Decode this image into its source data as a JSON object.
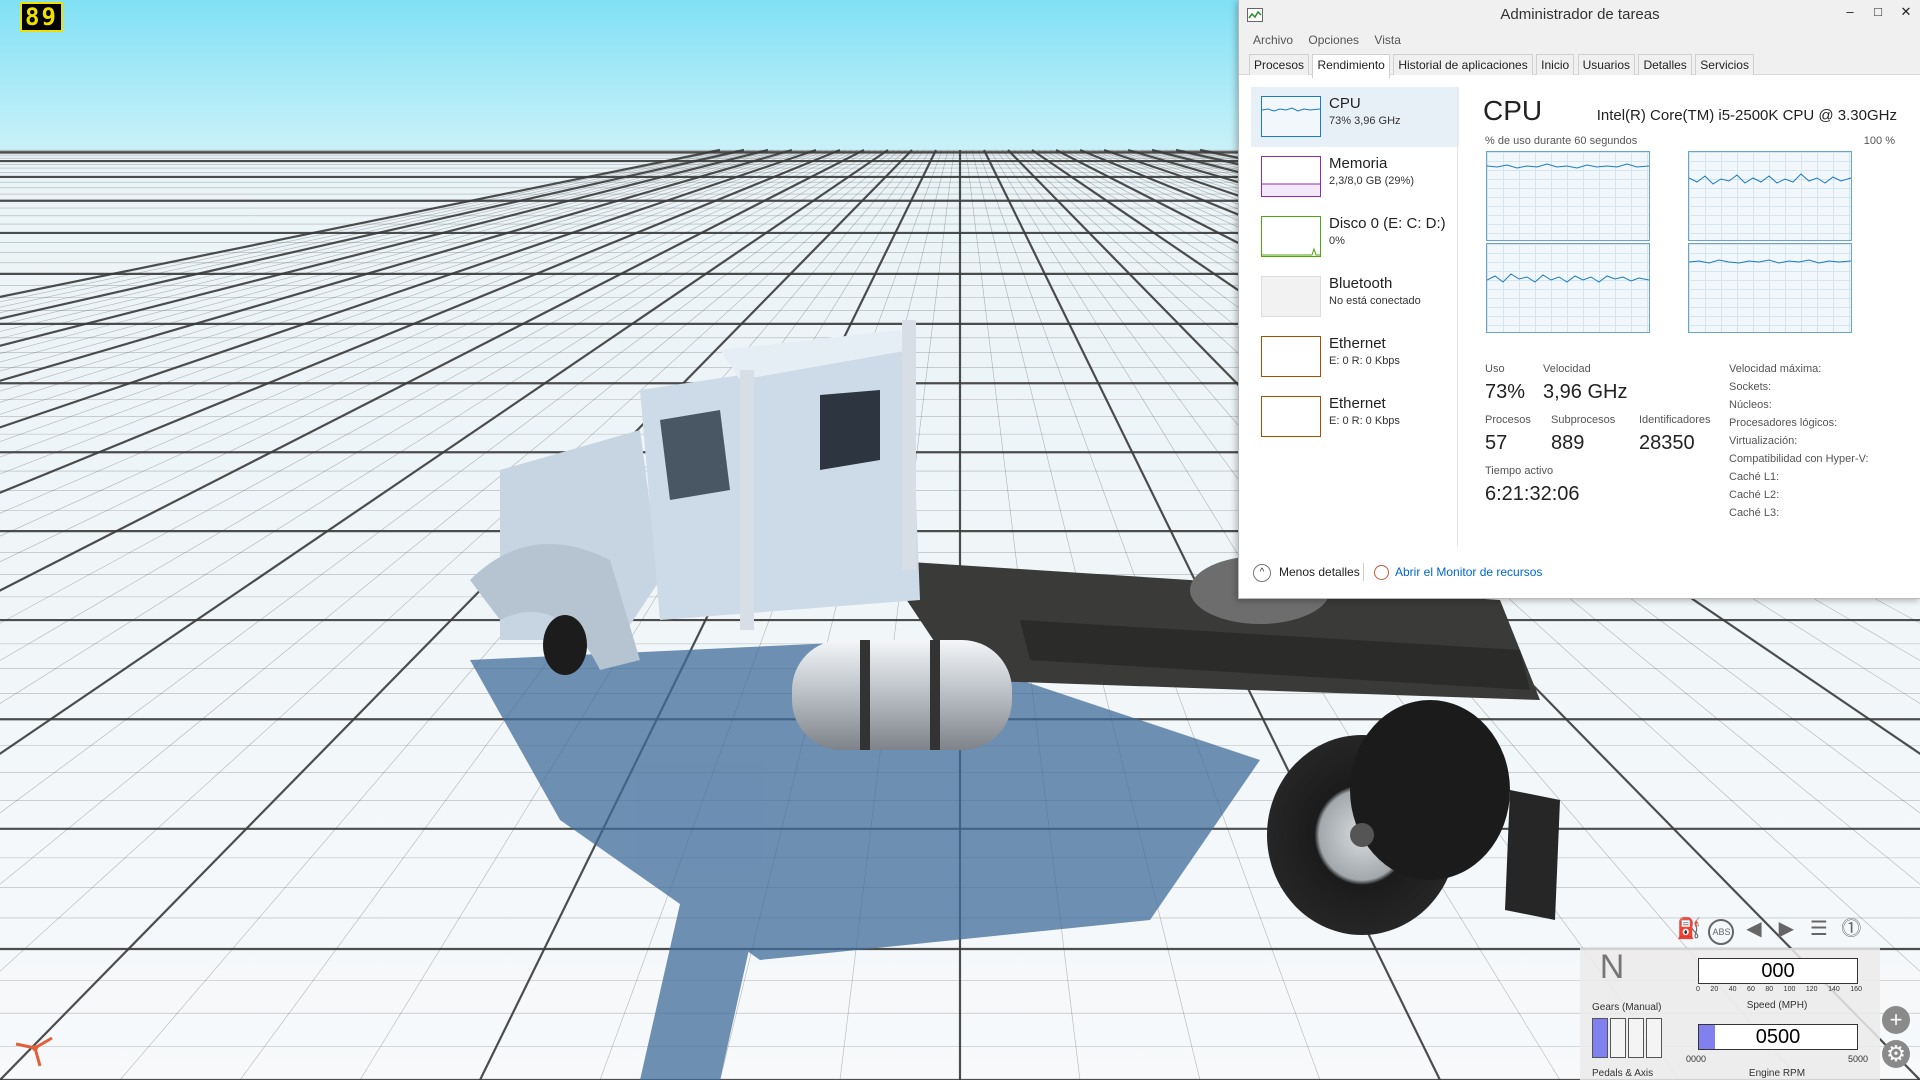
{
  "game": {
    "fps": "89",
    "colors": {
      "sky": "#a6e6f3",
      "ground": "#f2f6f8",
      "truck": "#c9d6e3"
    }
  },
  "taskmanager": {
    "title": "Administrador de tareas",
    "menu": [
      "Archivo",
      "Opciones",
      "Vista"
    ],
    "tabs": [
      "Procesos",
      "Rendimiento",
      "Historial de aplicaciones",
      "Inicio",
      "Usuarios",
      "Detalles",
      "Servicios"
    ],
    "active_tab": "Rendimiento",
    "sidebar": [
      {
        "name": "CPU",
        "sub": "73% 3,96 GHz",
        "color": "#1a7ac4"
      },
      {
        "name": "Memoria",
        "sub": "2,3/8,0 GB (29%)",
        "color": "#8b2bb9"
      },
      {
        "name": "Disco 0 (E: C: D:)",
        "sub": "0%",
        "color": "#4da60c"
      },
      {
        "name": "Bluetooth",
        "sub": "No está conectado",
        "color": "#c0c0c0"
      },
      {
        "name": "Ethernet",
        "sub": "E: 0 R: 0 Kbps",
        "color": "#a74f01"
      },
      {
        "name": "Ethernet",
        "sub": "E: 0 R: 0 Kbps",
        "color": "#a74f01"
      }
    ],
    "cpu": {
      "heading": "CPU",
      "model": "Intel(R) Core(TM) i5-2500K CPU @ 3.30GHz",
      "graph_caption": "% de uso durante 60 segundos",
      "graph_max": "100 %",
      "stats": {
        "uso_label": "Uso",
        "uso": "73%",
        "velocidad_label": "Velocidad",
        "velocidad": "3,96 GHz",
        "procesos_label": "Procesos",
        "procesos": "57",
        "subprocesos_label": "Subprocesos",
        "subprocesos": "889",
        "identificadores_label": "Identificadores",
        "identificadores": "28350",
        "tiempo_label": "Tiempo activo",
        "tiempo": "6:21:32:06"
      },
      "specs": [
        "Velocidad máxima:",
        "Sockets:",
        "Núcleos:",
        "Procesadores lógicos:",
        "Virtualización:",
        "Compatibilidad con Hyper-V:",
        "Caché L1:",
        "Caché L2:",
        "Caché L3:"
      ]
    },
    "footer": {
      "fewer_details": "Menos detalles",
      "open_monitor": "Abrir el Monitor de recursos"
    }
  },
  "hud": {
    "gear": "N",
    "gears_label": "Gears (Manual)",
    "pedals_label": "Pedals & Axis",
    "speed": "000",
    "speed_ticks": [
      "0",
      "20",
      "40",
      "60",
      "80",
      "100",
      "120",
      "140",
      "160"
    ],
    "speed_label": "Speed (MPH)",
    "rpm": "0500",
    "rpm_fraction": 0.1,
    "rpm_min": "0000",
    "rpm_max": "5000",
    "rpm_label": "Engine RPM",
    "pedals_fraction": [
      1,
      0,
      0,
      0
    ],
    "accent": "#8080ee",
    "icons": [
      "fuel-icon",
      "abs-icon",
      "left-signal-icon",
      "right-signal-icon",
      "headlight-icon",
      "warning-icon"
    ]
  }
}
